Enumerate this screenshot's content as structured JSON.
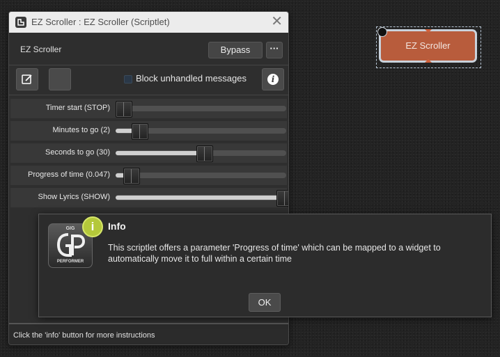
{
  "window": {
    "title": "EZ Scroller : EZ Scroller (Scriptlet)",
    "close_glyph": "✕",
    "plugin_name": "EZ Scroller",
    "bypass_label": "Bypass",
    "more_label": "···",
    "block_unhandled_label": "Block unhandled messages",
    "block_unhandled_checked": false,
    "info_glyph": "i",
    "status_text": "Click the 'info' button for more instructions"
  },
  "parameters": [
    {
      "label": "Timer start (STOP)",
      "value": 0.0
    },
    {
      "label": "Minutes to go (2)",
      "value": 0.1
    },
    {
      "label": "Seconds to go (30)",
      "value": 0.5
    },
    {
      "label": "Progress of time (0.047)",
      "value": 0.047
    },
    {
      "label": "Show Lyrics (SHOW)",
      "value": 1.0
    }
  ],
  "dialog": {
    "logo_top": "GIG",
    "logo_bottom": "PERFORMER",
    "badge_glyph": "i",
    "title": "Info",
    "message": "This scriptlet offers a parameter 'Progress of time' which can be mapped to a widget to automatically move it to full within a certain time",
    "ok_label": "OK"
  },
  "canvas": {
    "block_label": "EZ Scroller",
    "block_color": "#b85c3c"
  }
}
